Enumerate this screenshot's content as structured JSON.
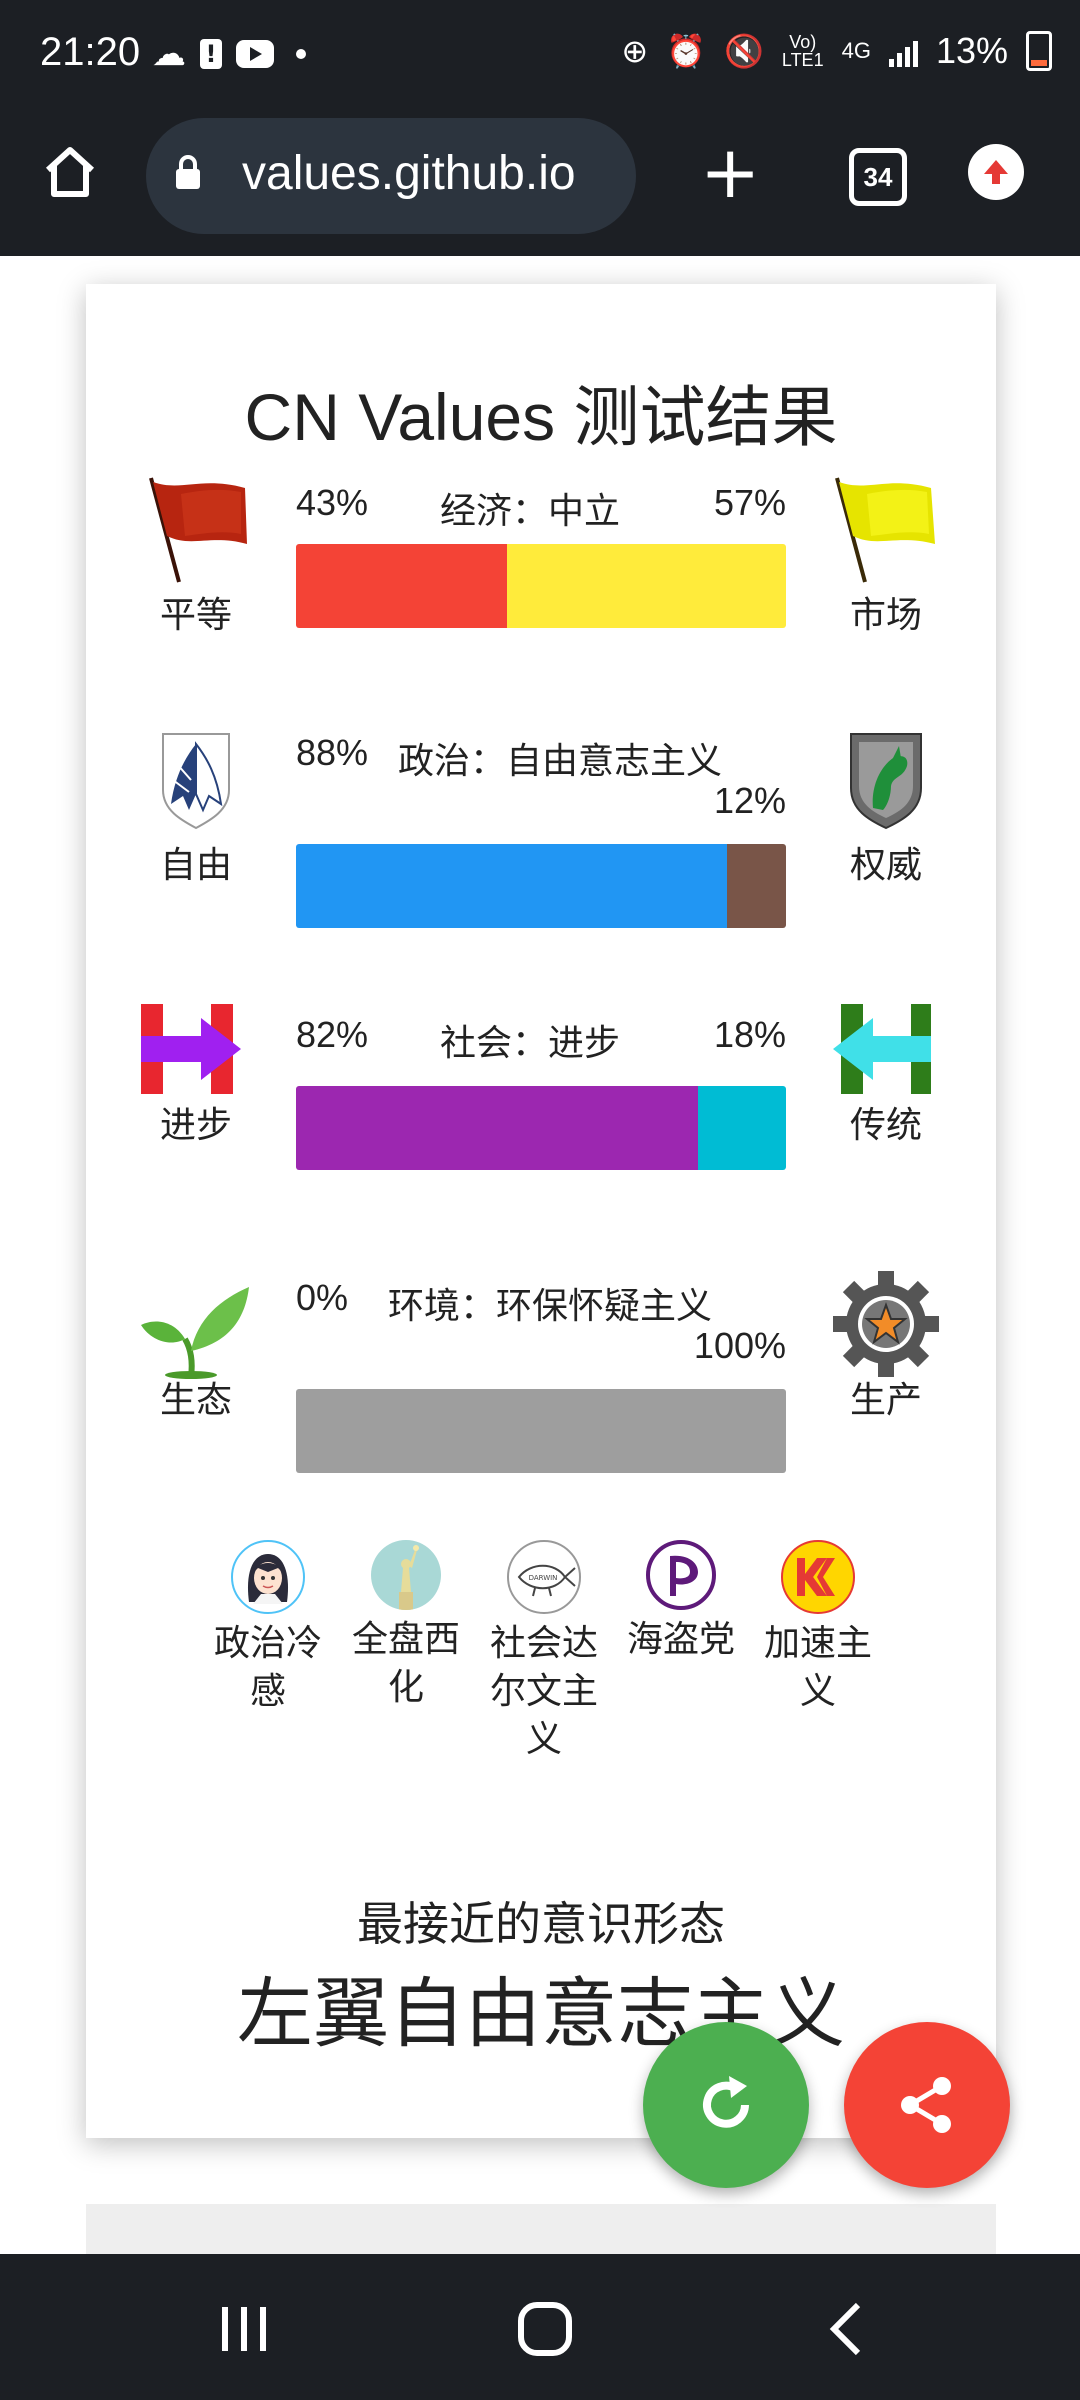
{
  "status_bar": {
    "time": "21:20",
    "left_icons": [
      "cloud-icon",
      "alert-icon",
      "youtube-icon",
      "dot-icon"
    ],
    "network_top": "Vo)",
    "network_bottom": "LTE1",
    "network_type": "4G",
    "battery_pct": "13%"
  },
  "browser": {
    "url": "values.github.io",
    "tab_count": "34"
  },
  "results": {
    "title": "CN Values 测试结果",
    "axes": [
      {
        "key": "economic",
        "left_label": "平等",
        "right_label": "市场",
        "left_pct": "43%",
        "right_pct": "57%",
        "axis_name": "经济：中立",
        "left_value": 43,
        "right_value": 57,
        "left_color": "#f44336",
        "right_color": "#ffeb3b",
        "left_icon": "red-flag-icon",
        "right_icon": "yellow-flag-icon"
      },
      {
        "key": "political",
        "left_label": "自由",
        "right_label": "权威",
        "left_pct": "88%",
        "right_pct": "12%",
        "axis_name": "政治：自由意志主义",
        "left_value": 88,
        "right_value": 12,
        "left_color": "#2196f3",
        "right_color": "#795548",
        "left_icon": "wings-emblem-icon",
        "right_icon": "horse-emblem-icon"
      },
      {
        "key": "social",
        "left_label": "进步",
        "right_label": "传统",
        "left_pct": "82%",
        "right_pct": "18%",
        "axis_name": "社会：进步",
        "left_value": 82,
        "right_value": 18,
        "left_color": "#9c27b0",
        "right_color": "#00bcd4",
        "left_icon": "arrow-right-h-icon",
        "right_icon": "arrow-left-h-icon"
      },
      {
        "key": "environment",
        "left_label": "生态",
        "right_label": "生产",
        "left_pct": "0%",
        "right_pct": "100%",
        "axis_name": "环境：环保怀疑主义",
        "left_value": 0,
        "right_value": 100,
        "left_color": "#4caf50",
        "right_color": "#9e9e9e",
        "left_icon": "sprout-icon",
        "right_icon": "gear-icon"
      }
    ],
    "tags": [
      {
        "label": "政治冷感",
        "icon": "anime-girl-icon"
      },
      {
        "label": "全盘西化",
        "icon": "statue-of-liberty-icon"
      },
      {
        "label": "社会达尔文主义",
        "icon": "darwin-fish-icon"
      },
      {
        "label": "海盗党",
        "icon": "pirate-party-icon"
      },
      {
        "label": "加速主义",
        "icon": "accelerationism-icon"
      }
    ],
    "closest_caption": "最接近的意识形态",
    "closest_name": "左翼自由意志主义"
  },
  "fabs": {
    "retake_color": "#4caf50",
    "share_color": "#f44336"
  }
}
